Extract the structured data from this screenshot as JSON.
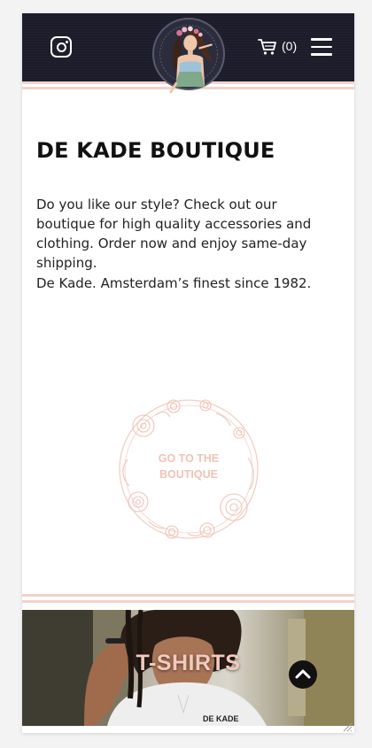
{
  "header": {
    "cart_count": "(0)",
    "icons": {
      "instagram": "instagram-icon",
      "cart": "cart-icon",
      "menu": "hamburger-menu-icon",
      "logo": "boutique-logo"
    }
  },
  "main": {
    "title": "DE KADE BOUTIQUE",
    "paragraph_1": "Do you like our style? Check out our boutique for high quality accessories and clothing. Order now and enjoy same-day shipping.",
    "paragraph_2": "De Kade. Amsterdam’s finest since 1982.",
    "boutique_link_line1": "GO TO THE",
    "boutique_link_line2": "BOUTIQUE"
  },
  "feature": {
    "title": "T-SHIRTS",
    "shirt_print": "DE KADE"
  },
  "colors": {
    "header_bg": "#1c1c2b",
    "accent_pink": "#f1d3c9",
    "badge_text": "#f0c3b6"
  }
}
